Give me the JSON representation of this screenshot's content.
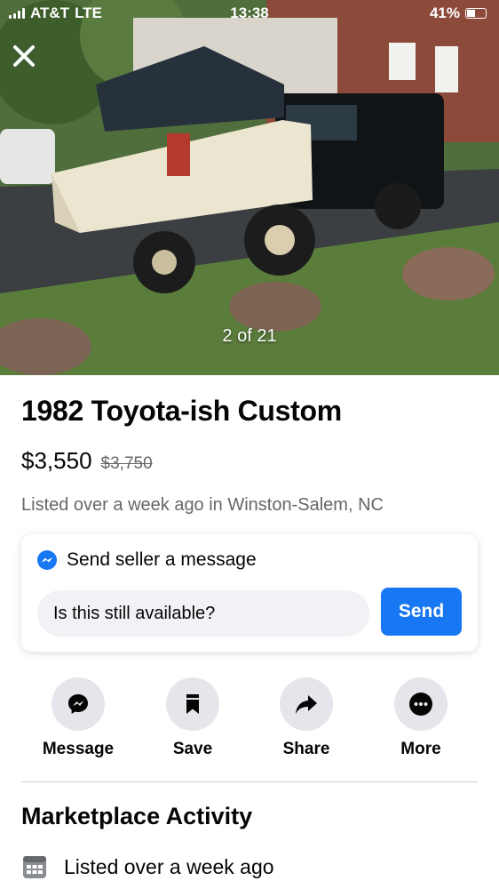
{
  "status_bar": {
    "carrier": "AT&T",
    "network": "LTE",
    "time": "13:38",
    "battery": "41%"
  },
  "photo": {
    "counter": "2 of 21",
    "icons": {
      "close": "close-icon"
    }
  },
  "listing": {
    "title": "1982 Toyota-ish Custom",
    "price": "$3,550",
    "original_price": "$3,750",
    "listed_info": "Listed over a week ago in Winston-Salem, NC"
  },
  "message_box": {
    "heading": "Send seller a message",
    "input_value": "Is this still available?",
    "send_label": "Send",
    "icon": "messenger-icon"
  },
  "actions": [
    {
      "label": "Message",
      "icon": "messenger-icon"
    },
    {
      "label": "Save",
      "icon": "bookmark-icon"
    },
    {
      "label": "Share",
      "icon": "share-arrow-icon"
    },
    {
      "label": "More",
      "icon": "more-dots-icon"
    }
  ],
  "activity": {
    "title": "Marketplace Activity",
    "items": [
      {
        "text": "Listed over a week ago",
        "icon": "calendar-icon"
      }
    ]
  },
  "colors": {
    "accent": "#1877f2",
    "secondary_text": "#65676b",
    "button_bg": "#e4e6eb",
    "input_bg": "#f0f2f5"
  }
}
